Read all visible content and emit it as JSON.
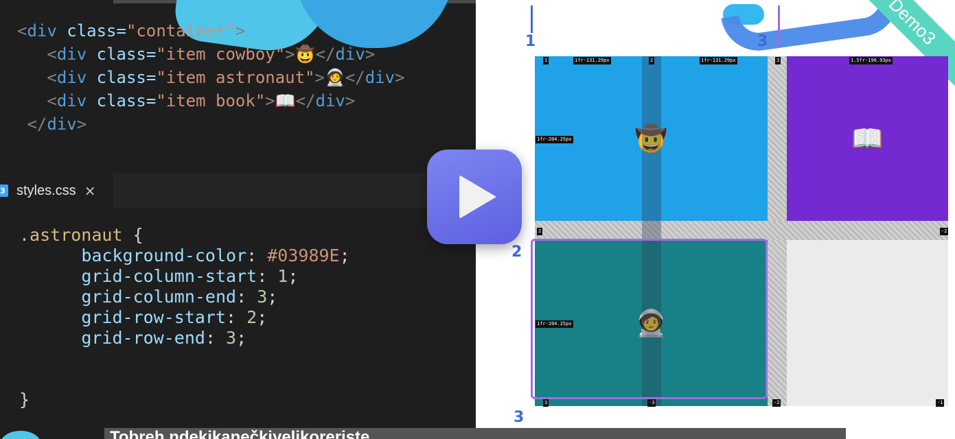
{
  "html_code": {
    "lines": [
      {
        "open": "<",
        "tag": "div",
        "attr": " class=",
        "str": "\"container\"",
        "close": ">",
        "emoji": "",
        "end": ""
      },
      {
        "open": "<",
        "tag": "div",
        "attr": " class=",
        "str": "\"item cowboy\"",
        "close": ">",
        "emoji": "🤠",
        "end": "</div>"
      },
      {
        "open": "<",
        "tag": "div",
        "attr": " class=",
        "str": "\"item astronaut\"",
        "close": ">",
        "emoji": "🧑‍🚀",
        "end": "</div>"
      },
      {
        "open": "<",
        "tag": "div",
        "attr": " class=",
        "str": "\"item book\"",
        "close": ">",
        "emoji": "📖",
        "end": "</div>"
      },
      {
        "open": "",
        "tag": "",
        "attr": "",
        "str": "",
        "close": "",
        "emoji": "",
        "end": "</div>"
      }
    ]
  },
  "tab": {
    "icon": "css3-icon",
    "label": "styles.css",
    "close": "×"
  },
  "css_code": {
    "selector": ".astronaut",
    "open_brace": "{",
    "props": [
      {
        "name": "background-color",
        "value": "#03989E"
      },
      {
        "name": "grid-column-start",
        "value": "1"
      },
      {
        "name": "grid-column-end",
        "value": "3"
      },
      {
        "name": "grid-row-start",
        "value": "2"
      },
      {
        "name": "grid-row-end",
        "value": "3"
      }
    ],
    "close_brace": "}"
  },
  "play_button": {
    "icon": "play-icon"
  },
  "demo": {
    "ribbon": "Demo3",
    "cells": {
      "cowboy": "🤠",
      "book": "📖",
      "astronaut": "🧑‍🚀"
    },
    "labels": {
      "col1": "1fr-131.29px",
      "col2": "1fr-131.29px",
      "col3": "1.5fr-196.93px",
      "row1": "1fr-204.25px",
      "row2": "1fr-204.25px",
      "n1": "1",
      "n2": "2",
      "n3": "3",
      "nneg1": "-1",
      "nneg2": "-2",
      "nneg3": "-3"
    },
    "hand": {
      "a": "1",
      "b": "3",
      "c": "2",
      "d": "3"
    },
    "colors": {
      "cowboy": "#1fa2e8",
      "book": "#7529d0",
      "astronaut": "#178187"
    }
  },
  "caption": "Tobreh ndekikanečkiyelikoreriste..."
}
